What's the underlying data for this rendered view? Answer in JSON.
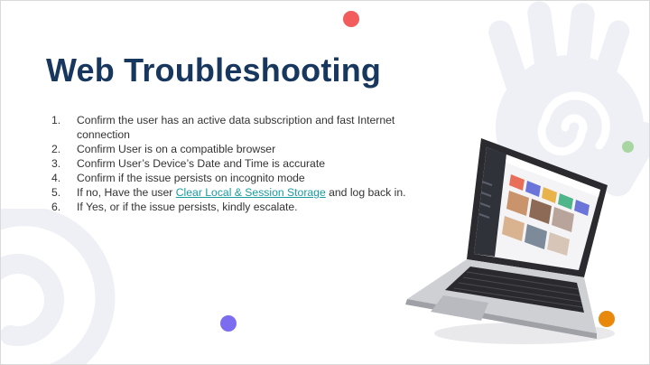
{
  "slide": {
    "title": "Web Troubleshooting",
    "steps": [
      {
        "number": "1.",
        "text": "Confirm the user has an active data subscription and fast Internet connection"
      },
      {
        "number": "2.",
        "text": "Confirm User is on a compatible browser"
      },
      {
        "number": "3.",
        "text": "Confirm User’s Device’s Date and Time is accurate"
      },
      {
        "number": "4.",
        "text": "Confirm if the issue persists on incognito mode"
      },
      {
        "number": "5.",
        "text_before": "If no, Have the user ",
        "link": "Clear Local & Session Storage",
        "text_after": " and log back in."
      },
      {
        "number": "6.",
        "text": "If Yes, or if the issue persists, kindly escalate."
      }
    ]
  },
  "icons": [
    "hand-watermark",
    "spiral-watermark",
    "laptop-illustration"
  ],
  "colors": {
    "title": "#17375e",
    "link": "#1a9ba1",
    "dot_red": "#f25c5c",
    "dot_green": "#a8d5a2",
    "dot_purple": "#7b6cf0",
    "dot_orange": "#e8890c"
  }
}
